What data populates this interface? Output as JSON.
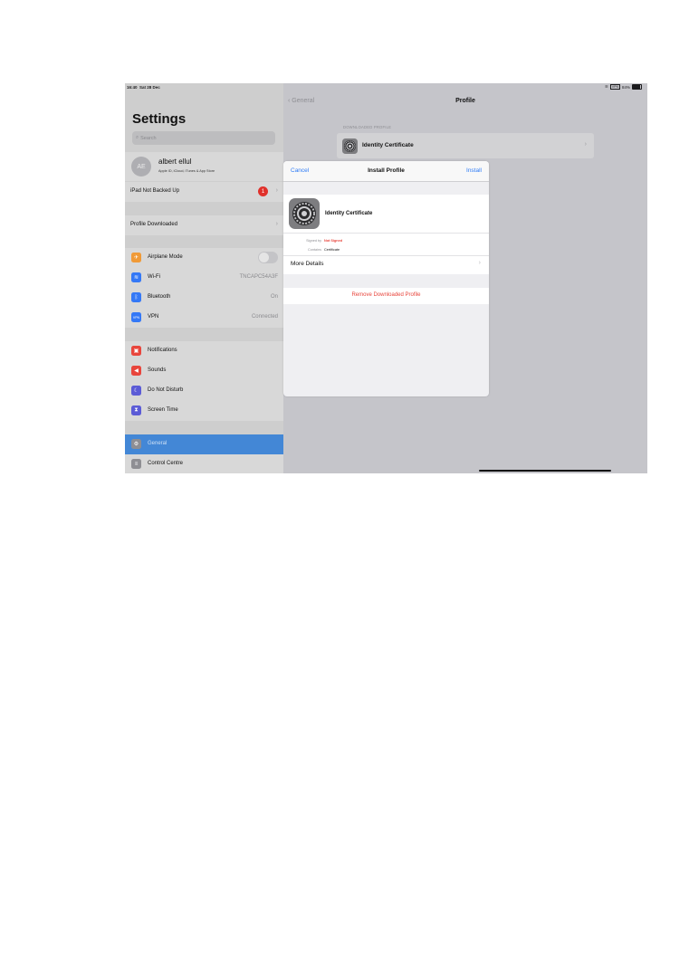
{
  "status_bar": {
    "time": "16:40",
    "date": "Sat 28 Dec",
    "battery": "84%"
  },
  "sidebar": {
    "title": "Settings",
    "search_placeholder": "Search",
    "account": {
      "initials": "AE",
      "name": "albert ellul",
      "subtitle": "Apple ID, iCloud, iTunes & App Store"
    },
    "backup": {
      "label": "iPad Not Backed Up",
      "badge": "1"
    },
    "profile_downloaded": {
      "label": "Profile Downloaded"
    },
    "group1": [
      {
        "label": "Airplane Mode",
        "icon": "airplane-icon",
        "color": "#f09a37",
        "glyph": "✈"
      },
      {
        "label": "Wi-Fi",
        "value": "TNCAPC54A3F",
        "icon": "wifi-icon",
        "color": "#3478f6",
        "glyph": "≋"
      },
      {
        "label": "Bluetooth",
        "value": "On",
        "icon": "bluetooth-icon",
        "color": "#3478f6",
        "glyph": "ᛒ"
      },
      {
        "label": "VPN",
        "value": "Connected",
        "icon": "vpn-icon",
        "color": "#3478f6",
        "glyph": "VPN"
      }
    ],
    "group2": [
      {
        "label": "Notifications",
        "icon": "notifications-icon",
        "color": "#e8453c",
        "glyph": "▣"
      },
      {
        "label": "Sounds",
        "icon": "sounds-icon",
        "color": "#e8453c",
        "glyph": "◀"
      },
      {
        "label": "Do Not Disturb",
        "icon": "moon-icon",
        "color": "#5b5bd6",
        "glyph": "☾"
      },
      {
        "label": "Screen Time",
        "icon": "hourglass-icon",
        "color": "#5b5bd6",
        "glyph": "⧗"
      }
    ],
    "group3": [
      {
        "label": "General",
        "icon": "gear-icon",
        "color": "#8e8e93",
        "glyph": "⚙",
        "selected": true
      },
      {
        "label": "Control Centre",
        "icon": "control-centre-icon",
        "color": "#8e8e93",
        "glyph": "≡"
      }
    ]
  },
  "detail": {
    "back_label": "General",
    "title": "Profile",
    "section_header": "DOWNLOADED PROFILE",
    "profile_name": "Identity Certificate"
  },
  "modal": {
    "cancel": "Cancel",
    "title": "Install Profile",
    "install": "Install",
    "profile_name": "Identity Certificate",
    "signed_by_key": "Signed by",
    "signed_by_value": "Not Signed",
    "contains_key": "Contains",
    "contains_value": "Certificate",
    "more_details": "More Details",
    "remove": "Remove Downloaded Profile",
    "colors": {
      "accent": "#2d7bf6",
      "danger": "#e8453c"
    }
  }
}
